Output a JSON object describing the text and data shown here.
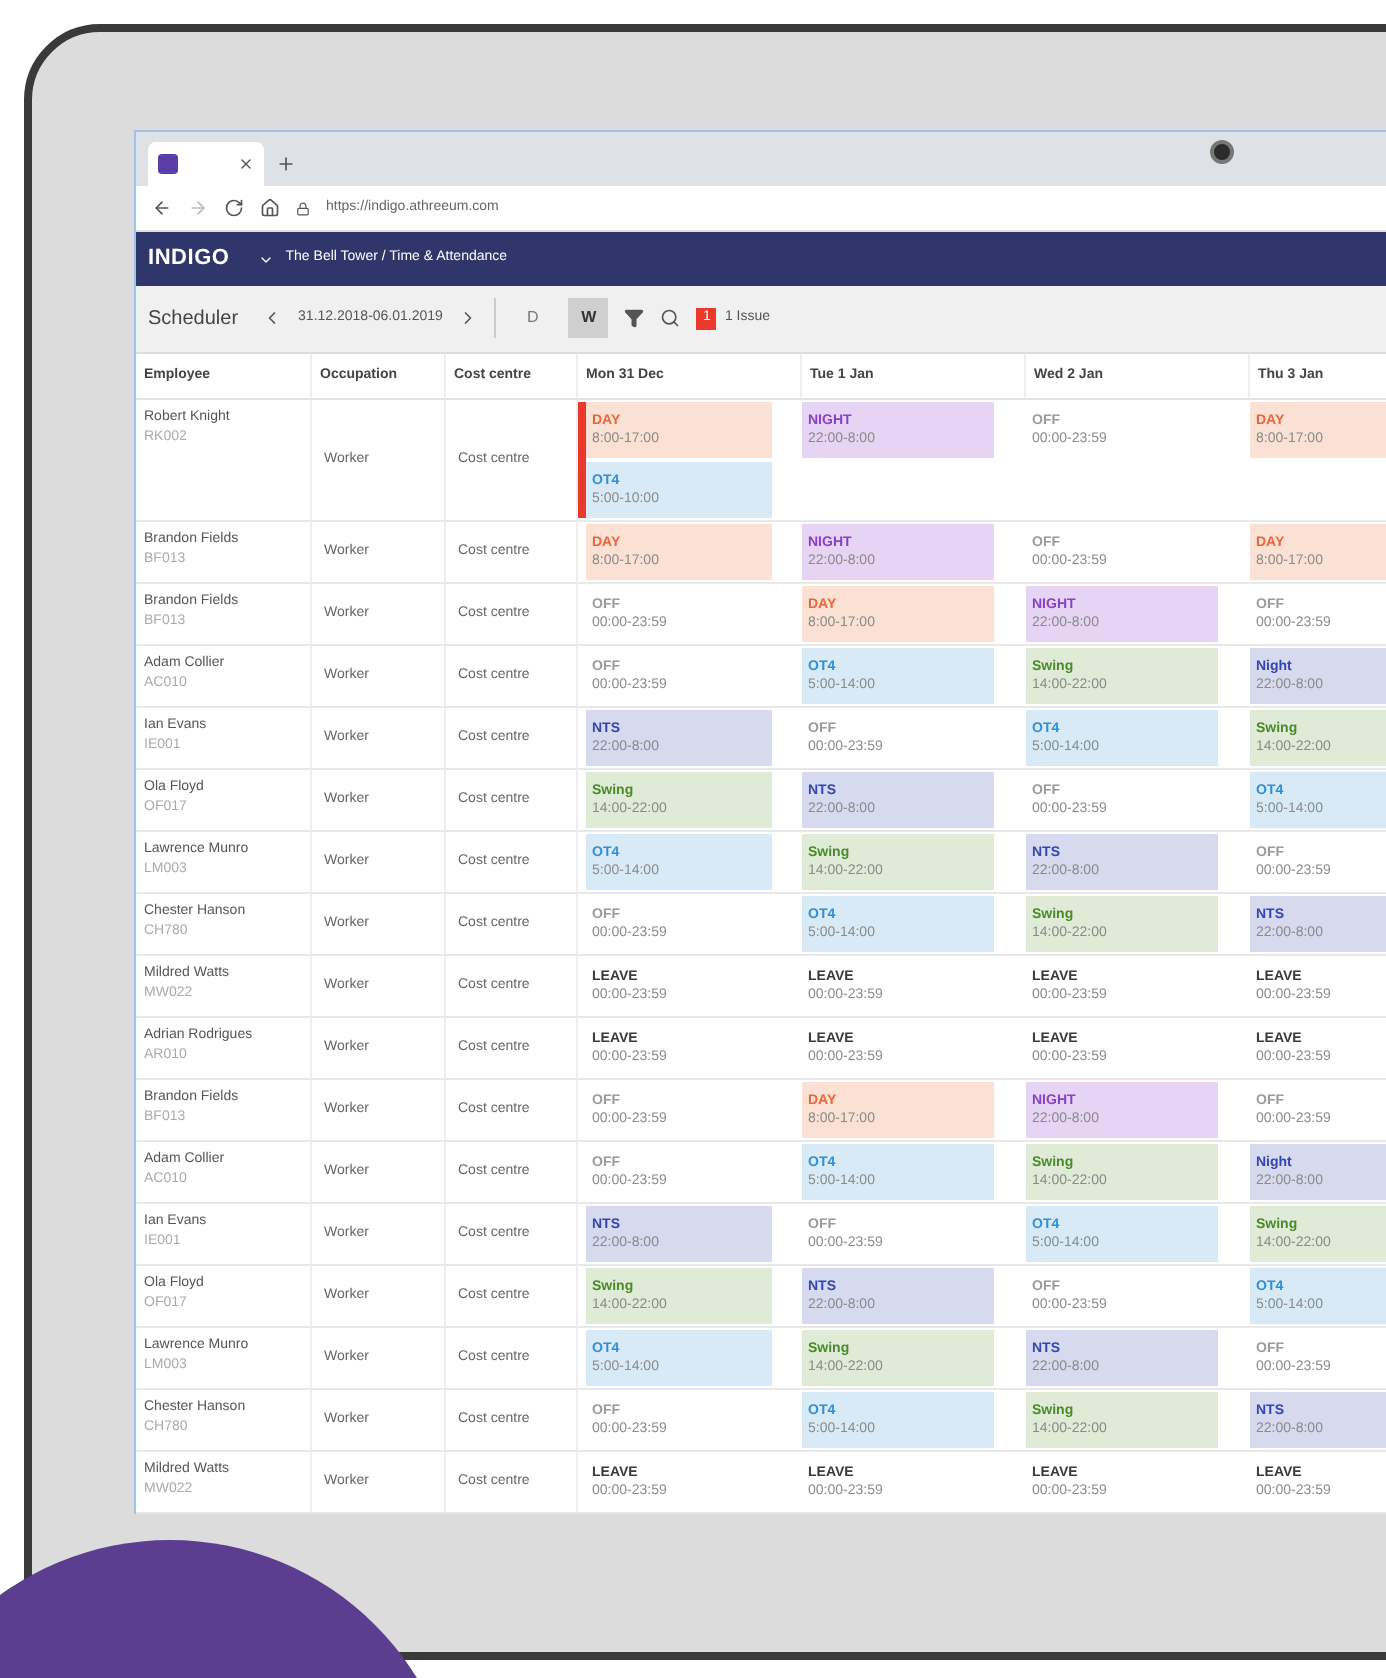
{
  "browser": {
    "url": "https://indigo.athreeum.com"
  },
  "app": {
    "logo": "INDIGO",
    "breadcrumb": "The Bell Tower / Time & Attendance"
  },
  "toolbar": {
    "title": "Scheduler",
    "date_range": "31.12.2018-06.01.2019",
    "views": [
      {
        "label": "D",
        "selected": false
      },
      {
        "label": "W",
        "selected": true
      }
    ],
    "issue_count": "1",
    "issue_label": "1 Issue"
  },
  "table": {
    "columns": [
      "Employee",
      "Occupation",
      "Cost centre",
      "Mon 31 Dec",
      "Tue 1 Jan",
      "Wed 2 Jan",
      "Thu 3 Jan"
    ],
    "rows": [
      {
        "name": "Robert Knight",
        "code": "RK002",
        "occupation": "Worker",
        "cost_centre": "Cost centre",
        "flagged": true,
        "shifts": [
          [
            {
              "kind": "day",
              "label": "DAY",
              "time": "8:00-17:00"
            },
            {
              "kind": "ot",
              "label": "OT4",
              "time": "5:00-10:00"
            }
          ],
          [
            {
              "kind": "night",
              "label": "NIGHT",
              "time": "22:00-8:00"
            }
          ],
          [
            {
              "kind": "off",
              "label": "OFF",
              "time": "00:00-23:59"
            }
          ],
          [
            {
              "kind": "day",
              "label": "DAY",
              "time": "8:00-17:00"
            }
          ]
        ]
      },
      {
        "name": "Brandon Fields",
        "code": "BF013",
        "occupation": "Worker",
        "cost_centre": "Cost centre",
        "flagged": false,
        "shifts": [
          [
            {
              "kind": "day",
              "label": "DAY",
              "time": "8:00-17:00"
            }
          ],
          [
            {
              "kind": "night",
              "label": "NIGHT",
              "time": "22:00-8:00"
            }
          ],
          [
            {
              "kind": "off",
              "label": "OFF",
              "time": "00:00-23:59"
            }
          ],
          [
            {
              "kind": "day",
              "label": "DAY",
              "time": "8:00-17:00"
            }
          ]
        ]
      },
      {
        "name": "Brandon Fields",
        "code": "BF013",
        "occupation": "Worker",
        "cost_centre": "Cost centre",
        "flagged": false,
        "shifts": [
          [
            {
              "kind": "off",
              "label": "OFF",
              "time": "00:00-23:59"
            }
          ],
          [
            {
              "kind": "day",
              "label": "DAY",
              "time": "8:00-17:00"
            }
          ],
          [
            {
              "kind": "night",
              "label": "NIGHT",
              "time": "22:00-8:00"
            }
          ],
          [
            {
              "kind": "off",
              "label": "OFF",
              "time": "00:00-23:59"
            }
          ]
        ]
      },
      {
        "name": "Adam Collier",
        "code": "AC010",
        "occupation": "Worker",
        "cost_centre": "Cost centre",
        "flagged": false,
        "shifts": [
          [
            {
              "kind": "off",
              "label": "OFF",
              "time": "00:00-23:59"
            }
          ],
          [
            {
              "kind": "ot",
              "label": "OT4",
              "time": "5:00-14:00"
            }
          ],
          [
            {
              "kind": "swing",
              "label": "Swing",
              "time": "14:00-22:00"
            }
          ],
          [
            {
              "kind": "nts",
              "label": "Night",
              "time": "22:00-8:00"
            }
          ]
        ]
      },
      {
        "name": "Ian Evans",
        "code": "IE001",
        "occupation": "Worker",
        "cost_centre": "Cost centre",
        "flagged": false,
        "shifts": [
          [
            {
              "kind": "nts",
              "label": "NTS",
              "time": "22:00-8:00"
            }
          ],
          [
            {
              "kind": "off",
              "label": "OFF",
              "time": "00:00-23:59"
            }
          ],
          [
            {
              "kind": "ot",
              "label": "OT4",
              "time": "5:00-14:00"
            }
          ],
          [
            {
              "kind": "swing",
              "label": "Swing",
              "time": "14:00-22:00"
            }
          ]
        ]
      },
      {
        "name": "Ola Floyd",
        "code": "OF017",
        "occupation": "Worker",
        "cost_centre": "Cost centre",
        "flagged": false,
        "shifts": [
          [
            {
              "kind": "swing",
              "label": "Swing",
              "time": "14:00-22:00"
            }
          ],
          [
            {
              "kind": "nts",
              "label": "NTS",
              "time": "22:00-8:00"
            }
          ],
          [
            {
              "kind": "off",
              "label": "OFF",
              "time": "00:00-23:59"
            }
          ],
          [
            {
              "kind": "ot",
              "label": "OT4",
              "time": "5:00-14:00"
            }
          ]
        ]
      },
      {
        "name": "Lawrence Munro",
        "code": "LM003",
        "occupation": "Worker",
        "cost_centre": "Cost centre",
        "flagged": false,
        "shifts": [
          [
            {
              "kind": "ot",
              "label": "OT4",
              "time": "5:00-14:00"
            }
          ],
          [
            {
              "kind": "swing",
              "label": "Swing",
              "time": "14:00-22:00"
            }
          ],
          [
            {
              "kind": "nts",
              "label": "NTS",
              "time": "22:00-8:00"
            }
          ],
          [
            {
              "kind": "off",
              "label": "OFF",
              "time": "00:00-23:59"
            }
          ]
        ]
      },
      {
        "name": "Chester Hanson",
        "code": "CH780",
        "occupation": "Worker",
        "cost_centre": "Cost centre",
        "flagged": false,
        "shifts": [
          [
            {
              "kind": "off",
              "label": "OFF",
              "time": "00:00-23:59"
            }
          ],
          [
            {
              "kind": "ot",
              "label": "OT4",
              "time": "5:00-14:00"
            }
          ],
          [
            {
              "kind": "swing",
              "label": "Swing",
              "time": "14:00-22:00"
            }
          ],
          [
            {
              "kind": "nts",
              "label": "NTS",
              "time": "22:00-8:00"
            }
          ]
        ]
      },
      {
        "name": "Mildred Watts",
        "code": "MW022",
        "occupation": "Worker",
        "cost_centre": "Cost centre",
        "flagged": false,
        "shifts": [
          [
            {
              "kind": "leave",
              "label": "LEAVE",
              "time": "00:00-23:59"
            }
          ],
          [
            {
              "kind": "leave",
              "label": "LEAVE",
              "time": "00:00-23:59"
            }
          ],
          [
            {
              "kind": "leave",
              "label": "LEAVE",
              "time": "00:00-23:59"
            }
          ],
          [
            {
              "kind": "leave",
              "label": "LEAVE",
              "time": "00:00-23:59"
            }
          ]
        ]
      },
      {
        "name": "Adrian Rodrigues",
        "code": "AR010",
        "occupation": "Worker",
        "cost_centre": "Cost centre",
        "flagged": false,
        "shifts": [
          [
            {
              "kind": "leave",
              "label": "LEAVE",
              "time": "00:00-23:59"
            }
          ],
          [
            {
              "kind": "leave",
              "label": "LEAVE",
              "time": "00:00-23:59"
            }
          ],
          [
            {
              "kind": "leave",
              "label": "LEAVE",
              "time": "00:00-23:59"
            }
          ],
          [
            {
              "kind": "leave",
              "label": "LEAVE",
              "time": "00:00-23:59"
            }
          ]
        ]
      },
      {
        "name": "Brandon Fields",
        "code": "BF013",
        "occupation": "Worker",
        "cost_centre": "Cost centre",
        "flagged": false,
        "shifts": [
          [
            {
              "kind": "off",
              "label": "OFF",
              "time": "00:00-23:59"
            }
          ],
          [
            {
              "kind": "day",
              "label": "DAY",
              "time": "8:00-17:00"
            }
          ],
          [
            {
              "kind": "night",
              "label": "NIGHT",
              "time": "22:00-8:00"
            }
          ],
          [
            {
              "kind": "off",
              "label": "OFF",
              "time": "00:00-23:59"
            }
          ]
        ]
      },
      {
        "name": "Adam Collier",
        "code": "AC010",
        "occupation": "Worker",
        "cost_centre": "Cost centre",
        "flagged": false,
        "shifts": [
          [
            {
              "kind": "off",
              "label": "OFF",
              "time": "00:00-23:59"
            }
          ],
          [
            {
              "kind": "ot",
              "label": "OT4",
              "time": "5:00-14:00"
            }
          ],
          [
            {
              "kind": "swing",
              "label": "Swing",
              "time": "14:00-22:00"
            }
          ],
          [
            {
              "kind": "nts",
              "label": "Night",
              "time": "22:00-8:00"
            }
          ]
        ]
      },
      {
        "name": "Ian Evans",
        "code": "IE001",
        "occupation": "Worker",
        "cost_centre": "Cost centre",
        "flagged": false,
        "shifts": [
          [
            {
              "kind": "nts",
              "label": "NTS",
              "time": "22:00-8:00"
            }
          ],
          [
            {
              "kind": "off",
              "label": "OFF",
              "time": "00:00-23:59"
            }
          ],
          [
            {
              "kind": "ot",
              "label": "OT4",
              "time": "5:00-14:00"
            }
          ],
          [
            {
              "kind": "swing",
              "label": "Swing",
              "time": "14:00-22:00"
            }
          ]
        ]
      },
      {
        "name": "Ola Floyd",
        "code": "OF017",
        "occupation": "Worker",
        "cost_centre": "Cost centre",
        "flagged": false,
        "shifts": [
          [
            {
              "kind": "swing",
              "label": "Swing",
              "time": "14:00-22:00"
            }
          ],
          [
            {
              "kind": "nts",
              "label": "NTS",
              "time": "22:00-8:00"
            }
          ],
          [
            {
              "kind": "off",
              "label": "OFF",
              "time": "00:00-23:59"
            }
          ],
          [
            {
              "kind": "ot",
              "label": "OT4",
              "time": "5:00-14:00"
            }
          ]
        ]
      },
      {
        "name": "Lawrence Munro",
        "code": "LM003",
        "occupation": "Worker",
        "cost_centre": "Cost centre",
        "flagged": false,
        "shifts": [
          [
            {
              "kind": "ot",
              "label": "OT4",
              "time": "5:00-14:00"
            }
          ],
          [
            {
              "kind": "swing",
              "label": "Swing",
              "time": "14:00-22:00"
            }
          ],
          [
            {
              "kind": "nts",
              "label": "NTS",
              "time": "22:00-8:00"
            }
          ],
          [
            {
              "kind": "off",
              "label": "OFF",
              "time": "00:00-23:59"
            }
          ]
        ]
      },
      {
        "name": "Chester Hanson",
        "code": "CH780",
        "occupation": "Worker",
        "cost_centre": "Cost centre",
        "flagged": false,
        "shifts": [
          [
            {
              "kind": "off",
              "label": "OFF",
              "time": "00:00-23:59"
            }
          ],
          [
            {
              "kind": "ot",
              "label": "OT4",
              "time": "5:00-14:00"
            }
          ],
          [
            {
              "kind": "swing",
              "label": "Swing",
              "time": "14:00-22:00"
            }
          ],
          [
            {
              "kind": "nts",
              "label": "NTS",
              "time": "22:00-8:00"
            }
          ]
        ]
      },
      {
        "name": "Mildred Watts",
        "code": "MW022",
        "occupation": "Worker",
        "cost_centre": "Cost centre",
        "flagged": false,
        "shifts": [
          [
            {
              "kind": "leave",
              "label": "LEAVE",
              "time": "00:00-23:59"
            }
          ],
          [
            {
              "kind": "leave",
              "label": "LEAVE",
              "time": "00:00-23:59"
            }
          ],
          [
            {
              "kind": "leave",
              "label": "LEAVE",
              "time": "00:00-23:59"
            }
          ],
          [
            {
              "kind": "leave",
              "label": "LEAVE",
              "time": "00:00-23:59"
            }
          ]
        ]
      }
    ]
  }
}
